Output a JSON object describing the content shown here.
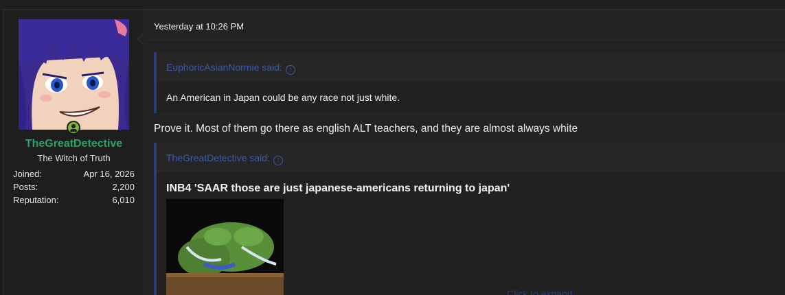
{
  "user": {
    "name": "TheGreatDetective",
    "title": "The Witch of Truth",
    "stats": [
      {
        "label": "Joined:",
        "value": "Apr 16, 2026"
      },
      {
        "label": "Posts:",
        "value": "2,200"
      },
      {
        "label": "Reputation:",
        "value": "6,010"
      }
    ]
  },
  "post": {
    "timestamp": "Yesterday at 10:26 PM",
    "quotes": [
      {
        "author": "EuphoricAsianNormie said:",
        "text": "An American in Japan could be any race not just white."
      },
      {
        "author": "TheGreatDetective said:",
        "text": "INB4 'SAAR those are just japanese-americans returning to japan'",
        "expand_label": "Click to expand..."
      }
    ],
    "reply": "Prove it. Most of them go there as english ALT teachers, and they are almost always white"
  },
  "colors": {
    "accent_user": "#2aa36b",
    "quote_border": "#2c3e7a",
    "quote_author": "#3e5aa8"
  },
  "icons": {
    "online": "online-user-icon",
    "quote_jump": "arrow-up-circle-icon"
  }
}
